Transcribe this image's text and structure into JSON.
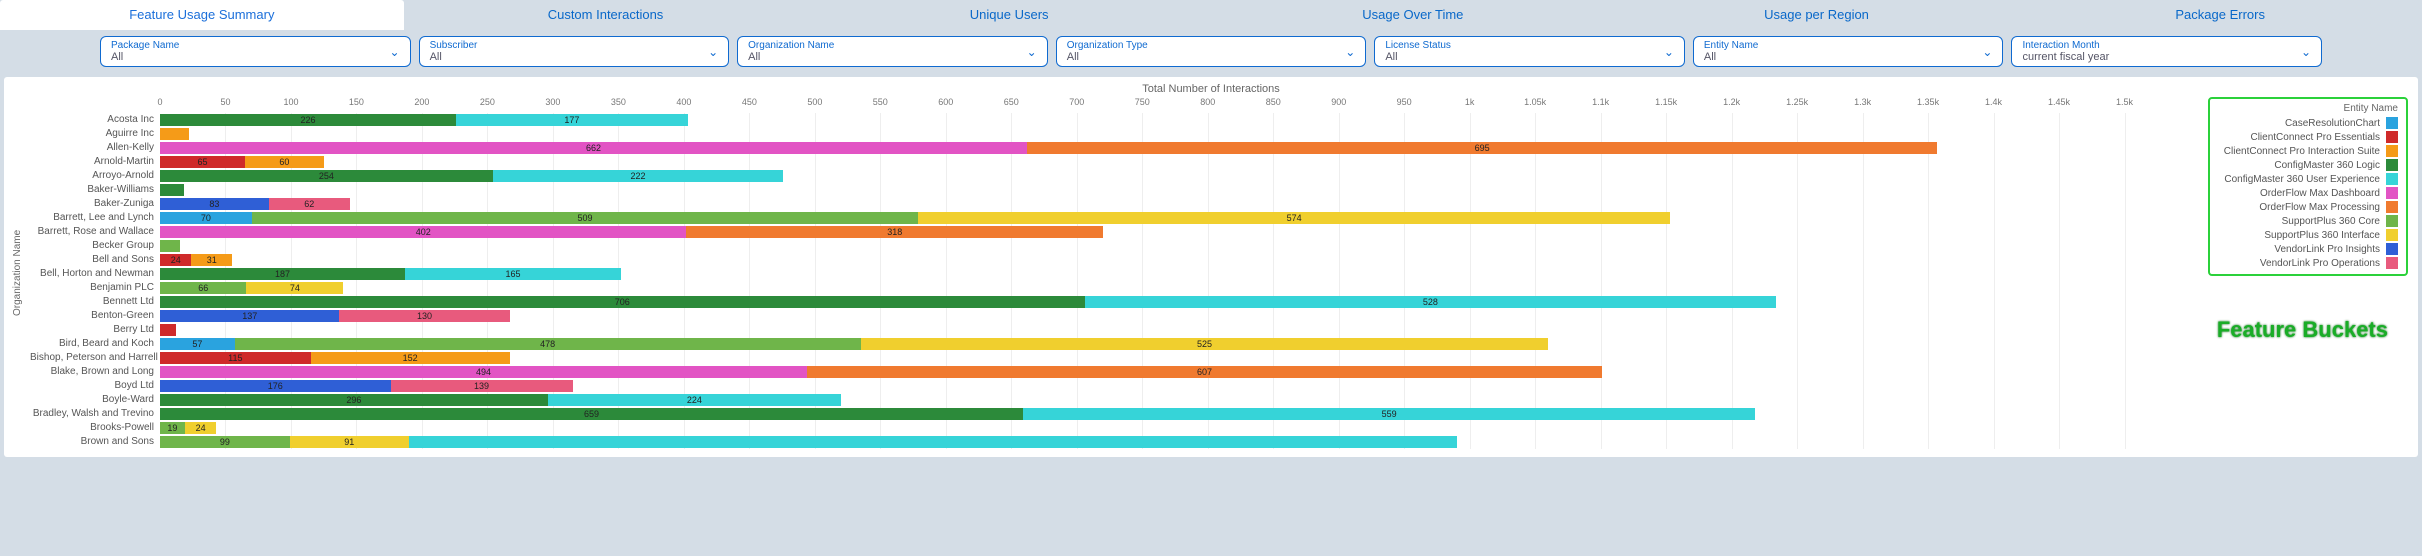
{
  "tabs": [
    "Feature Usage Summary",
    "Custom Interactions",
    "Unique Users",
    "Usage Over Time",
    "Usage per Region",
    "Package Errors"
  ],
  "active_tab": 0,
  "filters": [
    {
      "label": "Package Name",
      "value": "All"
    },
    {
      "label": "Subscriber",
      "value": "All"
    },
    {
      "label": "Organization Name",
      "value": "All"
    },
    {
      "label": "Organization Type",
      "value": "All"
    },
    {
      "label": "License Status",
      "value": "All"
    },
    {
      "label": "Entity Name",
      "value": "All"
    },
    {
      "label": "Interaction Month",
      "value": "current fiscal year"
    }
  ],
  "feature_buckets_label": "Feature Buckets",
  "legend_title": "Entity Name",
  "entities": [
    {
      "name": "CaseResolutionChart",
      "color": "#2aa3df"
    },
    {
      "name": "ClientConnect Pro Essentials",
      "color": "#cf2a2a"
    },
    {
      "name": "ClientConnect Pro Interaction Suite",
      "color": "#f59b18"
    },
    {
      "name": "ConfigMaster 360 Logic",
      "color": "#2c8a3a"
    },
    {
      "name": "ConfigMaster 360 User Experience",
      "color": "#36d4d8"
    },
    {
      "name": "OrderFlow Max Dashboard",
      "color": "#e254c4"
    },
    {
      "name": "OrderFlow Max Processing",
      "color": "#f07a2f"
    },
    {
      "name": "SupportPlus 360 Core",
      "color": "#6fb54a"
    },
    {
      "name": "SupportPlus 360 Interface",
      "color": "#f0cf2e"
    },
    {
      "name": "VendorLink Pro Insights",
      "color": "#2f5fd6"
    },
    {
      "name": "VendorLink Pro Operations",
      "color": "#e85a7d"
    }
  ],
  "chart_data": {
    "type": "bar",
    "stacked": true,
    "title": "Total Number of Interactions",
    "xlabel": "",
    "ylabel": "Organization Name",
    "xlim": [
      0,
      1550
    ],
    "ticks": [
      0,
      50,
      100,
      150,
      200,
      250,
      300,
      350,
      400,
      450,
      500,
      550,
      600,
      650,
      700,
      750,
      800,
      850,
      900,
      950,
      "1k",
      "1.05k",
      "1.1k",
      "1.15k",
      "1.2k",
      "1.25k",
      "1.3k",
      "1.35k",
      "1.4k",
      "1.45k",
      "1.5k"
    ],
    "tick_values": [
      0,
      50,
      100,
      150,
      200,
      250,
      300,
      350,
      400,
      450,
      500,
      550,
      600,
      650,
      700,
      750,
      800,
      850,
      900,
      950,
      1000,
      1050,
      1100,
      1150,
      1200,
      1250,
      1300,
      1350,
      1400,
      1450,
      1500
    ],
    "categories": [
      "Acosta Inc",
      "Aguirre Inc",
      "Allen-Kelly",
      "Arnold-Martin",
      "Arroyo-Arnold",
      "Baker-Williams",
      "Baker-Zuniga",
      "Barrett, Lee and Lynch",
      "Barrett, Rose and Wallace",
      "Becker Group",
      "Bell and Sons",
      "Bell, Horton and Newman",
      "Benjamin PLC",
      "Bennett Ltd",
      "Benton-Green",
      "Berry Ltd",
      "Bird, Beard and Koch",
      "Bishop, Peterson and Harrell",
      "Blake, Brown and Long",
      "Boyd Ltd",
      "Boyle-Ward",
      "Bradley, Walsh and Trevino",
      "Brooks-Powell",
      "Brown and Sons"
    ],
    "series_keys": [
      "CaseResolutionChart",
      "ClientConnect Pro Essentials",
      "ClientConnect Pro Interaction Suite",
      "ConfigMaster 360 Logic",
      "ConfigMaster 360 User Experience",
      "OrderFlow Max Dashboard",
      "OrderFlow Max Processing",
      "SupportPlus 360 Core",
      "SupportPlus 360 Interface",
      "VendorLink Pro Insights",
      "VendorLink Pro Operations"
    ],
    "rows": [
      {
        "org": "Acosta Inc",
        "segs": [
          {
            "k": "ConfigMaster 360 Logic",
            "v": 226,
            "label": "226"
          },
          {
            "k": "ConfigMaster 360 User Experience",
            "v": 177,
            "label": "177"
          }
        ]
      },
      {
        "org": "Aguirre Inc",
        "segs": [
          {
            "k": "ClientConnect Pro Interaction Suite",
            "v": 22
          }
        ]
      },
      {
        "org": "Allen-Kelly",
        "segs": [
          {
            "k": "OrderFlow Max Dashboard",
            "v": 662,
            "label": "662"
          },
          {
            "k": "OrderFlow Max Processing",
            "v": 695,
            "label": "695"
          }
        ]
      },
      {
        "org": "Arnold-Martin",
        "segs": [
          {
            "k": "ClientConnect Pro Essentials",
            "v": 65,
            "label": "65"
          },
          {
            "k": "ClientConnect Pro Interaction Suite",
            "v": 60,
            "label": "60"
          }
        ]
      },
      {
        "org": "Arroyo-Arnold",
        "segs": [
          {
            "k": "ConfigMaster 360 Logic",
            "v": 254,
            "label": "254"
          },
          {
            "k": "ConfigMaster 360 User Experience",
            "v": 222,
            "label": "222"
          }
        ]
      },
      {
        "org": "Baker-Williams",
        "segs": [
          {
            "k": "ConfigMaster 360 Logic",
            "v": 18
          }
        ]
      },
      {
        "org": "Baker-Zuniga",
        "segs": [
          {
            "k": "VendorLink Pro Insights",
            "v": 83,
            "label": "83"
          },
          {
            "k": "VendorLink Pro Operations",
            "v": 62,
            "label": "62"
          }
        ]
      },
      {
        "org": "Barrett, Lee and Lynch",
        "segs": [
          {
            "k": "CaseResolutionChart",
            "v": 70,
            "label": "70"
          },
          {
            "k": "SupportPlus 360 Core",
            "v": 509,
            "label": "509"
          },
          {
            "k": "SupportPlus 360 Interface",
            "v": 574,
            "label": "574"
          }
        ]
      },
      {
        "org": "Barrett, Rose and Wallace",
        "segs": [
          {
            "k": "OrderFlow Max Dashboard",
            "v": 402,
            "label": "402"
          },
          {
            "k": "OrderFlow Max Processing",
            "v": 318,
            "label": "318"
          }
        ]
      },
      {
        "org": "Becker Group",
        "segs": [
          {
            "k": "SupportPlus 360 Core",
            "v": 15
          }
        ]
      },
      {
        "org": "Bell and Sons",
        "segs": [
          {
            "k": "ClientConnect Pro Essentials",
            "v": 24,
            "label": "24"
          },
          {
            "k": "ClientConnect Pro Interaction Suite",
            "v": 31,
            "label": "31"
          }
        ]
      },
      {
        "org": "Bell, Horton and Newman",
        "segs": [
          {
            "k": "ConfigMaster 360 Logic",
            "v": 187,
            "label": "187"
          },
          {
            "k": "ConfigMaster 360 User Experience",
            "v": 165,
            "label": "165"
          }
        ]
      },
      {
        "org": "Benjamin PLC",
        "segs": [
          {
            "k": "SupportPlus 360 Core",
            "v": 66,
            "label": "66"
          },
          {
            "k": "SupportPlus 360 Interface",
            "v": 74,
            "label": "74"
          }
        ]
      },
      {
        "org": "Bennett Ltd",
        "segs": [
          {
            "k": "ConfigMaster 360 Logic",
            "v": 706,
            "label": "706"
          },
          {
            "k": "ConfigMaster 360 User Experience",
            "v": 528,
            "label": "528"
          }
        ]
      },
      {
        "org": "Benton-Green",
        "segs": [
          {
            "k": "VendorLink Pro Insights",
            "v": 137,
            "label": "137"
          },
          {
            "k": "VendorLink Pro Operations",
            "v": 130,
            "label": "130"
          }
        ]
      },
      {
        "org": "Berry Ltd",
        "segs": [
          {
            "k": "ClientConnect Pro Essentials",
            "v": 12
          }
        ]
      },
      {
        "org": "Bird, Beard and Koch",
        "segs": [
          {
            "k": "CaseResolutionChart",
            "v": 57,
            "label": "57"
          },
          {
            "k": "SupportPlus 360 Core",
            "v": 478,
            "label": "478"
          },
          {
            "k": "SupportPlus 360 Interface",
            "v": 525,
            "label": "525"
          }
        ]
      },
      {
        "org": "Bishop, Peterson and Harrell",
        "segs": [
          {
            "k": "ClientConnect Pro Essentials",
            "v": 115,
            "label": "115"
          },
          {
            "k": "ClientConnect Pro Interaction Suite",
            "v": 152,
            "label": "152"
          }
        ]
      },
      {
        "org": "Blake, Brown and Long",
        "segs": [
          {
            "k": "OrderFlow Max Dashboard",
            "v": 494,
            "label": "494"
          },
          {
            "k": "OrderFlow Max Processing",
            "v": 607,
            "label": "607"
          }
        ]
      },
      {
        "org": "Boyd Ltd",
        "segs": [
          {
            "k": "VendorLink Pro Insights",
            "v": 176,
            "label": "176"
          },
          {
            "k": "VendorLink Pro Operations",
            "v": 139,
            "label": "139"
          }
        ]
      },
      {
        "org": "Boyle-Ward",
        "segs": [
          {
            "k": "ConfigMaster 360 Logic",
            "v": 296,
            "label": "296"
          },
          {
            "k": "ConfigMaster 360 User Experience",
            "v": 224,
            "label": "224"
          }
        ]
      },
      {
        "org": "Bradley, Walsh and Trevino",
        "segs": [
          {
            "k": "ConfigMaster 360 Logic",
            "v": 659,
            "label": "659"
          },
          {
            "k": "ConfigMaster 360 User Experience",
            "v": 559,
            "label": "559"
          }
        ]
      },
      {
        "org": "Brooks-Powell",
        "segs": [
          {
            "k": "SupportPlus 360 Core",
            "v": 19,
            "label": "19"
          },
          {
            "k": "SupportPlus 360 Interface",
            "v": 24,
            "label": "24"
          }
        ]
      },
      {
        "org": "Brown and Sons",
        "segs": [
          {
            "k": "SupportPlus 360 Core",
            "v": 99,
            "label": "99"
          },
          {
            "k": "SupportPlus 360 Interface",
            "v": 91,
            "label": "91"
          },
          {
            "k": "ConfigMaster 360 User Experience",
            "v": 800
          }
        ]
      }
    ]
  }
}
